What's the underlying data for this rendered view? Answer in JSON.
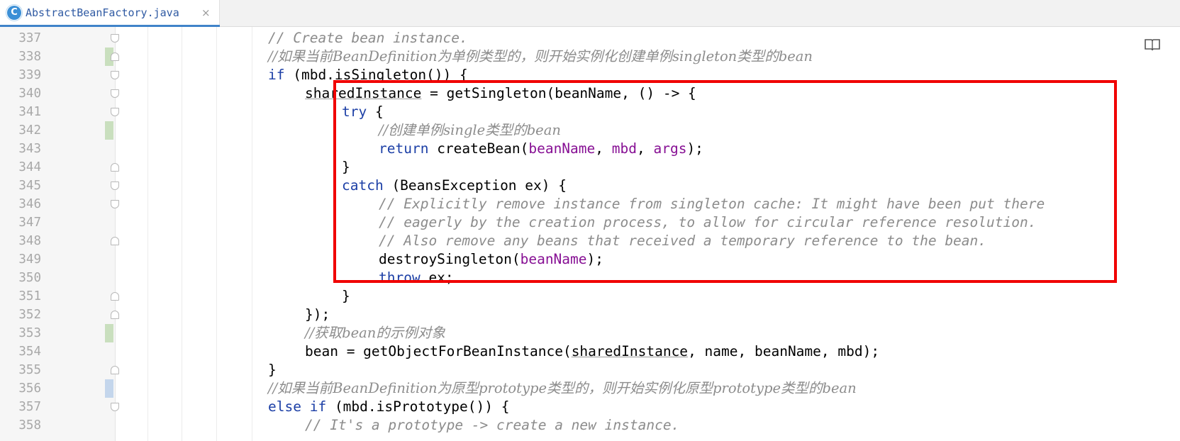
{
  "tab": {
    "icon_letter": "C",
    "file_name": "AbstractBeanFactory.java",
    "close_glyph": "×"
  },
  "editor": {
    "reader_mode_icon": "book-icon",
    "colors": {
      "keyword": "#1c3fa6",
      "comment": "#8c8c8c",
      "parameter": "#871094",
      "highlight_box": "#f00000",
      "vcs_modified": "#c9dfbe",
      "vcs_changed": "#c4d6ec"
    },
    "lines": [
      {
        "num": "337",
        "vcs": "",
        "fold": "open",
        "indent": 0,
        "tokens": [
          {
            "t": "// Create bean instance.",
            "c": "cm"
          }
        ]
      },
      {
        "num": "338",
        "vcs": "green",
        "fold": "close",
        "indent": 0,
        "tokens": [
          {
            "t": "//如果当前BeanDefinition为单例类型的，则开始实例化创建单例singleton类型的bean",
            "c": "cm"
          }
        ]
      },
      {
        "num": "339",
        "vcs": "",
        "fold": "open",
        "indent": 0,
        "tokens": [
          {
            "t": "if",
            "c": "kw"
          },
          {
            "t": " (mbd.isSingleton()) {",
            "c": ""
          }
        ]
      },
      {
        "num": "340",
        "vcs": "",
        "fold": "open",
        "indent": 1,
        "tokens": [
          {
            "t": "sharedInstance",
            "c": "ul"
          },
          {
            "t": " = getSingleton(beanName, () -> {",
            "c": ""
          }
        ]
      },
      {
        "num": "341",
        "vcs": "",
        "fold": "open",
        "indent": 2,
        "tokens": [
          {
            "t": "try",
            "c": "kw"
          },
          {
            "t": " {",
            "c": ""
          }
        ]
      },
      {
        "num": "342",
        "vcs": "green",
        "fold": "",
        "indent": 3,
        "tokens": [
          {
            "t": "//创建单例single类型的bean",
            "c": "cm"
          }
        ]
      },
      {
        "num": "343",
        "vcs": "",
        "fold": "",
        "indent": 3,
        "tokens": [
          {
            "t": "return",
            "c": "kw"
          },
          {
            "t": " createBean(",
            "c": ""
          },
          {
            "t": "beanName",
            "c": "pv"
          },
          {
            "t": ", ",
            "c": ""
          },
          {
            "t": "mbd",
            "c": "pv"
          },
          {
            "t": ", ",
            "c": ""
          },
          {
            "t": "args",
            "c": "pv"
          },
          {
            "t": ");",
            "c": ""
          }
        ]
      },
      {
        "num": "344",
        "vcs": "",
        "fold": "close",
        "indent": 2,
        "tokens": [
          {
            "t": "}",
            "c": ""
          }
        ]
      },
      {
        "num": "345",
        "vcs": "",
        "fold": "open",
        "indent": 2,
        "tokens": [
          {
            "t": "catch",
            "c": "kw"
          },
          {
            "t": " (BeansException ex) {",
            "c": ""
          }
        ]
      },
      {
        "num": "346",
        "vcs": "",
        "fold": "open",
        "indent": 3,
        "tokens": [
          {
            "t": "// Explicitly remove instance from singleton cache: It might have been put there",
            "c": "cm"
          }
        ]
      },
      {
        "num": "347",
        "vcs": "",
        "fold": "",
        "indent": 3,
        "tokens": [
          {
            "t": "// eagerly by the creation process, to allow for circular reference resolution.",
            "c": "cm"
          }
        ]
      },
      {
        "num": "348",
        "vcs": "",
        "fold": "close",
        "indent": 3,
        "tokens": [
          {
            "t": "// Also remove any beans that received a temporary reference to the bean.",
            "c": "cm"
          }
        ]
      },
      {
        "num": "349",
        "vcs": "",
        "fold": "",
        "indent": 3,
        "tokens": [
          {
            "t": "destroySingleton(",
            "c": ""
          },
          {
            "t": "beanName",
            "c": "pv"
          },
          {
            "t": ");",
            "c": ""
          }
        ]
      },
      {
        "num": "350",
        "vcs": "",
        "fold": "",
        "indent": 3,
        "tokens": [
          {
            "t": "throw",
            "c": "kw"
          },
          {
            "t": " ex;",
            "c": ""
          }
        ]
      },
      {
        "num": "351",
        "vcs": "",
        "fold": "close",
        "indent": 2,
        "tokens": [
          {
            "t": "}",
            "c": ""
          }
        ]
      },
      {
        "num": "352",
        "vcs": "",
        "fold": "close",
        "indent": 1,
        "tokens": [
          {
            "t": "});",
            "c": ""
          }
        ]
      },
      {
        "num": "353",
        "vcs": "green",
        "fold": "",
        "indent": 1,
        "tokens": [
          {
            "t": "//获取bean的示例对象",
            "c": "cm"
          }
        ]
      },
      {
        "num": "354",
        "vcs": "",
        "fold": "",
        "indent": 1,
        "tokens": [
          {
            "t": "bean = getObjectForBeanInstance(",
            "c": ""
          },
          {
            "t": "sharedInstance",
            "c": "ul"
          },
          {
            "t": ", name, beanName, mbd);",
            "c": ""
          }
        ]
      },
      {
        "num": "355",
        "vcs": "",
        "fold": "close",
        "indent": 0,
        "tokens": [
          {
            "t": "}",
            "c": ""
          }
        ]
      },
      {
        "num": "356",
        "vcs": "blue",
        "fold": "",
        "indent": 0,
        "tokens": [
          {
            "t": "//如果当前BeanDefinition为原型prototype类型的，则开始实例化原型prototype类型的bean",
            "c": "cm"
          }
        ]
      },
      {
        "num": "357",
        "vcs": "",
        "fold": "open",
        "indent": 0,
        "tokens": [
          {
            "t": "else",
            "c": "kw"
          },
          {
            "t": " ",
            "c": ""
          },
          {
            "t": "if",
            "c": "kw"
          },
          {
            "t": " (mbd.isPrototype()) {",
            "c": ""
          }
        ]
      },
      {
        "num": "358",
        "vcs": "",
        "fold": "",
        "indent": 1,
        "tokens": [
          {
            "t": "// It's a prototype -> create a new instance.",
            "c": "cm"
          }
        ]
      }
    ]
  }
}
